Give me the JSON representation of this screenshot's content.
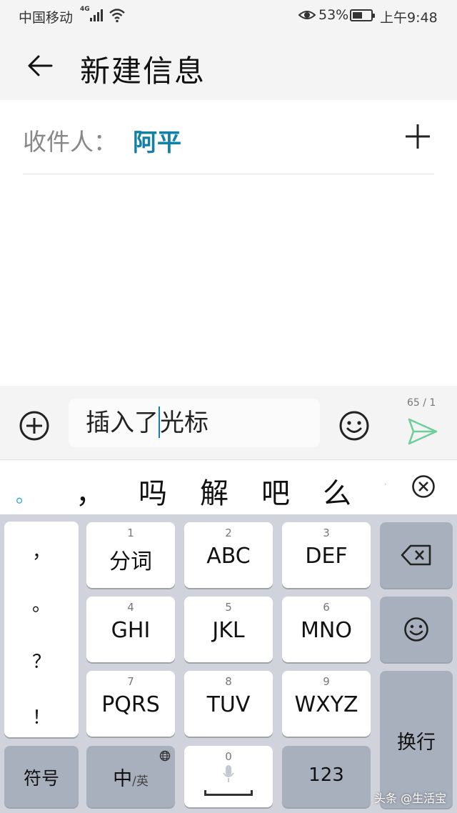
{
  "status_bar": {
    "carrier": "中国移动",
    "network": "4G",
    "battery": "53%",
    "battery_level": 0.53,
    "time": "上午9:48"
  },
  "header": {
    "title": "新建信息"
  },
  "recipient": {
    "label": "收件人：",
    "name": "阿平"
  },
  "composer": {
    "text_before_cursor": "插入了",
    "text_after_cursor": "光标",
    "counter": "65 / 1"
  },
  "candidates": [
    "。",
    "，",
    "吗",
    "解",
    "吧",
    "么",
    "？"
  ],
  "keyboard": {
    "punctuation": [
      "，",
      "。",
      "？",
      "！"
    ],
    "keys": [
      {
        "num": "1",
        "label": "分词"
      },
      {
        "num": "2",
        "label": "ABC"
      },
      {
        "num": "3",
        "label": "DEF"
      },
      {
        "num": "4",
        "label": "GHI"
      },
      {
        "num": "5",
        "label": "JKL"
      },
      {
        "num": "6",
        "label": "MNO"
      },
      {
        "num": "7",
        "label": "PQRS"
      },
      {
        "num": "8",
        "label": "TUV"
      },
      {
        "num": "9",
        "label": "WXYZ"
      }
    ],
    "enter": "换行",
    "symbols": "符号",
    "lang_main": "中",
    "lang_sub": "/英",
    "space_num": "0",
    "numbers": "123"
  },
  "watermark": "头条 @生活宝",
  "colors": {
    "accent": "#1380a8",
    "send": "#6dcf9a",
    "keyboard_bg": "#d0d3dc"
  }
}
